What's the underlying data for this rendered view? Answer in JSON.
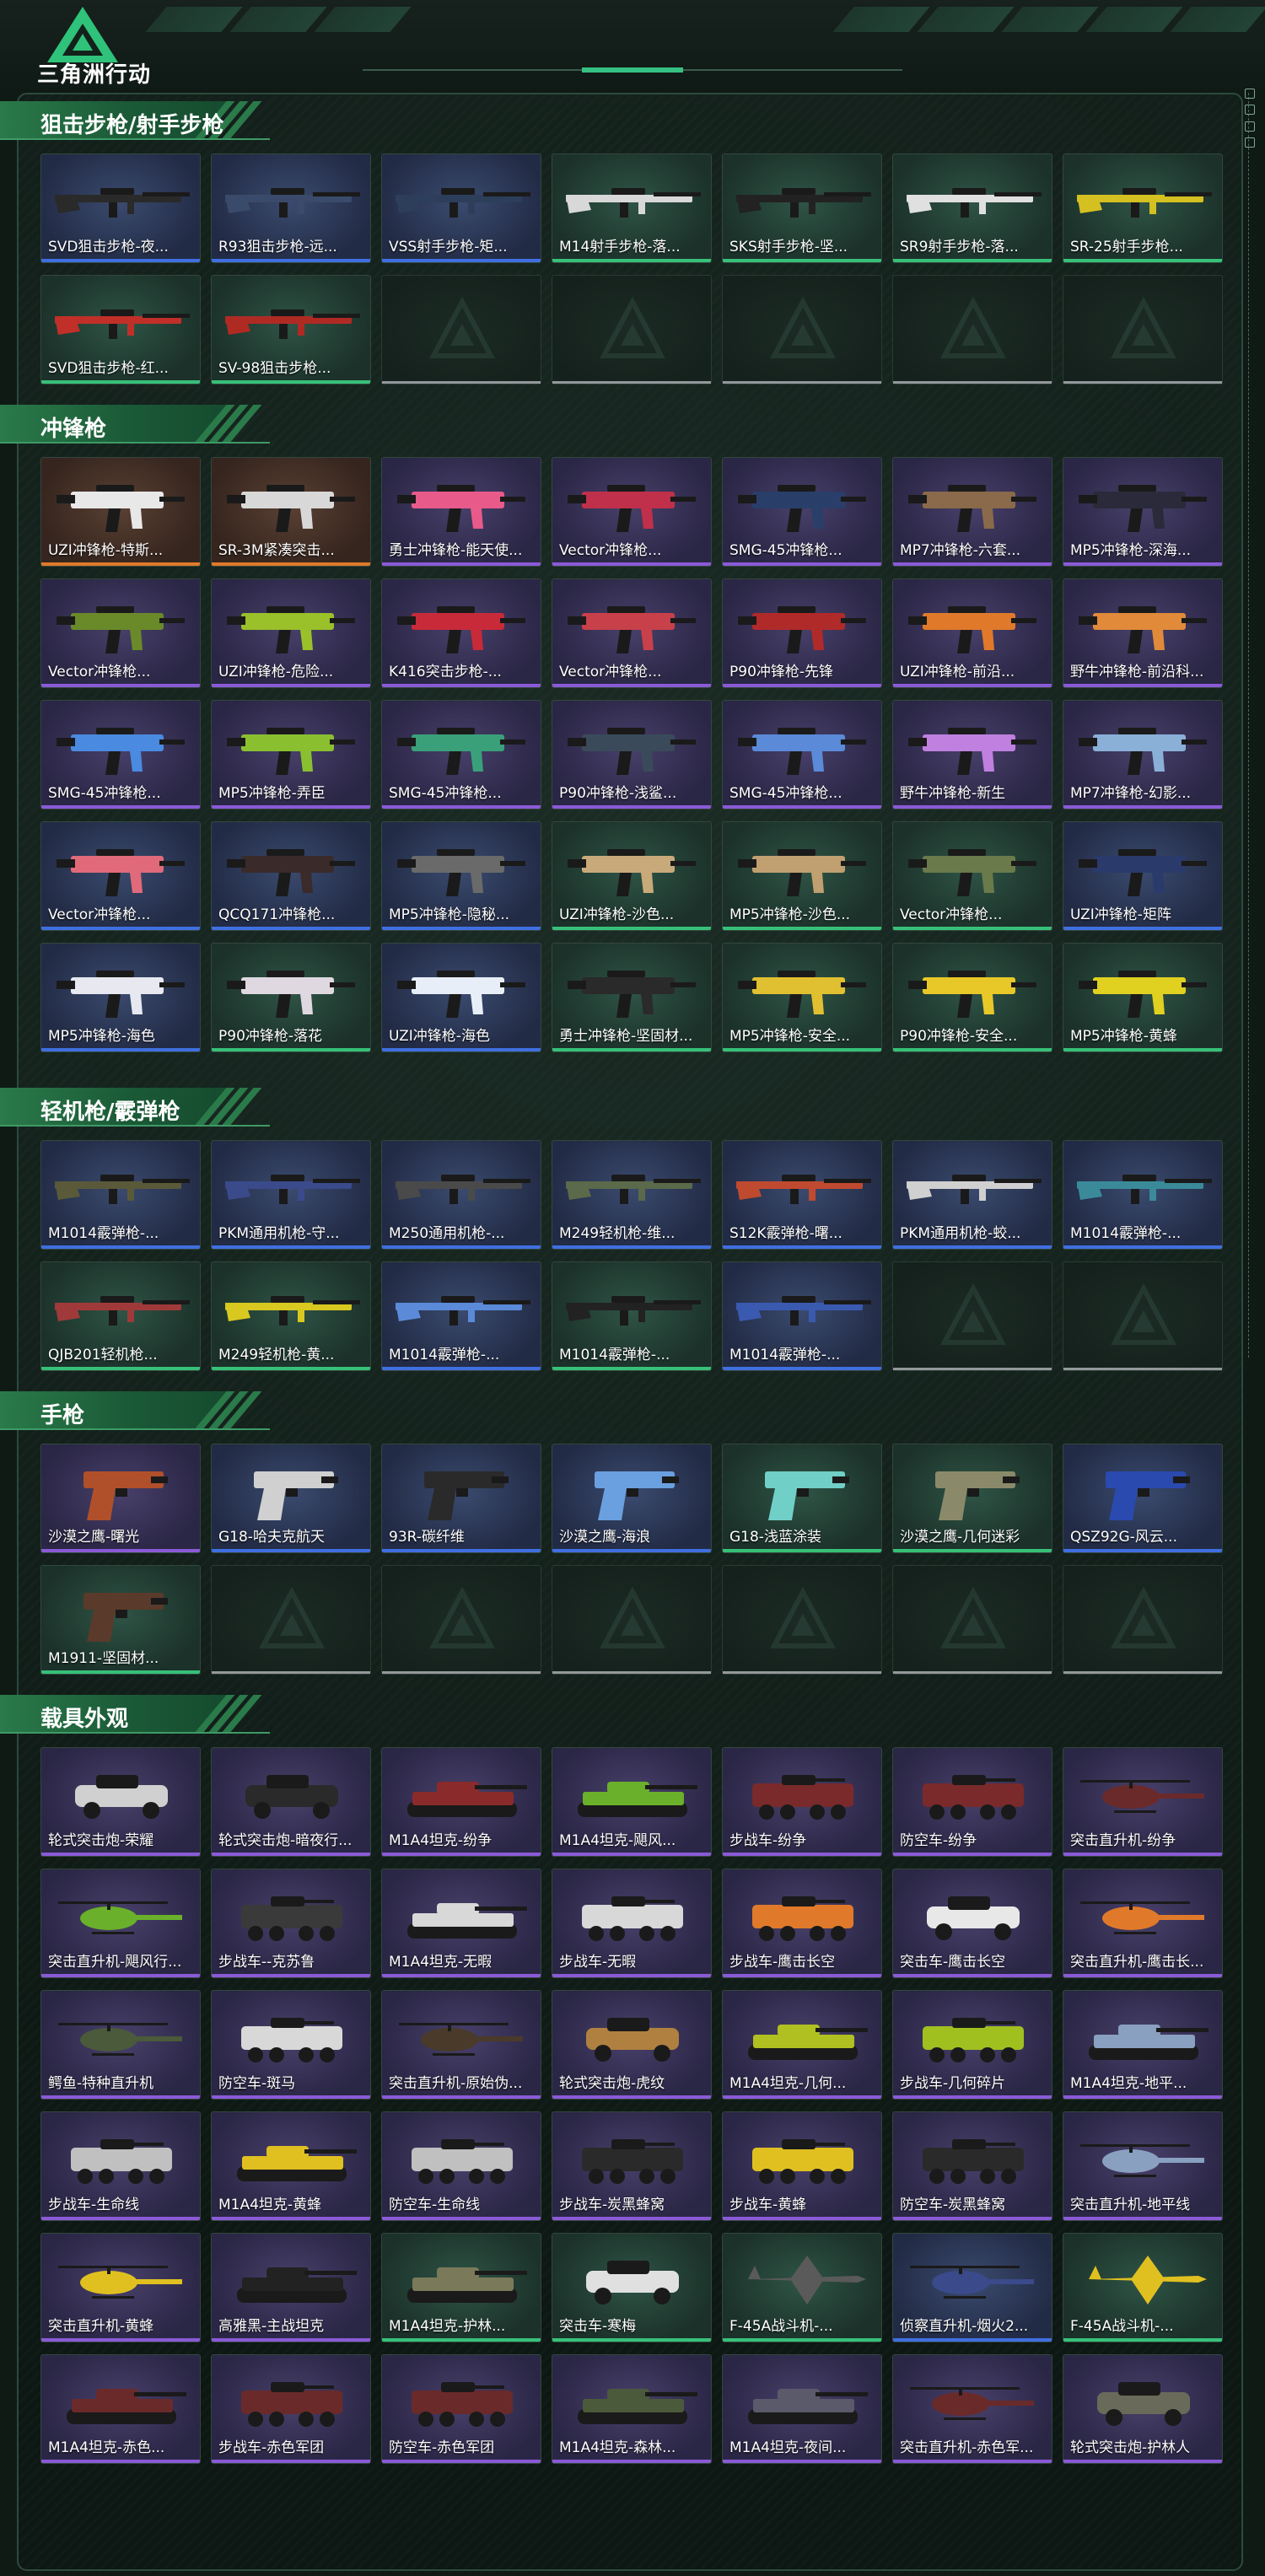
{
  "app": {
    "logo_text": "三角洲行动"
  },
  "colors": {
    "accent": "#2a7a4a",
    "rarity_purple": "#8a5ad6",
    "rarity_blue": "#3f6fe0",
    "rarity_green": "#37c078",
    "rarity_orange": "#e07a2a"
  },
  "sections": [
    {
      "title": "狙击步枪/射手步枪",
      "items": [
        {
          "label": "SVD狙击步枪-夜...",
          "rarity": "blue",
          "kind": "rifle",
          "color": "#2a2a2a"
        },
        {
          "label": "R93狙击步枪-远...",
          "rarity": "blue",
          "kind": "rifle",
          "color": "#3a4a6a"
        },
        {
          "label": "VSS射手步枪-矩...",
          "rarity": "blue",
          "kind": "rifle",
          "color": "#2c3e5a"
        },
        {
          "label": "M14射手步枪-落...",
          "rarity": "green",
          "kind": "rifle",
          "color": "#d8d8d8"
        },
        {
          "label": "SKS射手步枪-坚...",
          "rarity": "green",
          "kind": "rifle",
          "color": "#222222"
        },
        {
          "label": "SR9射手步枪-落...",
          "rarity": "green",
          "kind": "rifle",
          "color": "#e0e0e0"
        },
        {
          "label": "SR-25射手步枪...",
          "rarity": "green",
          "kind": "rifle",
          "color": "#d4c020"
        },
        {
          "label": "SVD狙击步枪-红...",
          "rarity": "green",
          "kind": "rifle",
          "color": "#c03028"
        },
        {
          "label": "SV-98狙击步枪...",
          "rarity": "green",
          "kind": "rifle",
          "color": "#b02a24"
        }
      ],
      "empty_count": 5
    },
    {
      "title": "冲锋枪",
      "items": [
        {
          "label": "UZI冲锋枪-特斯...",
          "rarity": "orange",
          "kind": "smg",
          "color": "#e8e8e8"
        },
        {
          "label": "SR-3M紧凑突击...",
          "rarity": "orange",
          "kind": "smg",
          "color": "#d8d8d8"
        },
        {
          "label": "勇士冲锋枪-能天使...",
          "rarity": "purple",
          "kind": "smg",
          "color": "#e85a8a"
        },
        {
          "label": "Vector冲锋枪...",
          "rarity": "purple",
          "kind": "smg",
          "color": "#c0304a"
        },
        {
          "label": "SMG-45冲锋枪...",
          "rarity": "purple",
          "kind": "smg",
          "color": "#2a3e6a"
        },
        {
          "label": "MP7冲锋枪-六套...",
          "rarity": "purple",
          "kind": "smg",
          "color": "#8a6a4a"
        },
        {
          "label": "MP5冲锋枪-深海...",
          "rarity": "purple",
          "kind": "smg",
          "color": "#2a2a3a"
        },
        {
          "label": "Vector冲锋枪...",
          "rarity": "purple",
          "kind": "smg",
          "color": "#6a8a2a"
        },
        {
          "label": "UZI冲锋枪-危险...",
          "rarity": "purple",
          "kind": "smg",
          "color": "#9ac02a"
        },
        {
          "label": "K416突击步枪-...",
          "rarity": "purple",
          "kind": "smg",
          "color": "#c82a3a"
        },
        {
          "label": "Vector冲锋枪...",
          "rarity": "purple",
          "kind": "smg",
          "color": "#c8404a"
        },
        {
          "label": "P90冲锋枪-先锋",
          "rarity": "purple",
          "kind": "smg",
          "color": "#b02a2a"
        },
        {
          "label": "UZI冲锋枪-前沿...",
          "rarity": "purple",
          "kind": "smg",
          "color": "#e07a2a"
        },
        {
          "label": "野牛冲锋枪-前沿科...",
          "rarity": "purple",
          "kind": "smg",
          "color": "#e08a3a"
        },
        {
          "label": "SMG-45冲锋枪...",
          "rarity": "purple",
          "kind": "smg",
          "color": "#4a8ae0"
        },
        {
          "label": "MP5冲锋枪-弄臣",
          "rarity": "purple",
          "kind": "smg",
          "color": "#8ac030"
        },
        {
          "label": "SMG-45冲锋枪...",
          "rarity": "purple",
          "kind": "smg",
          "color": "#3aa07a"
        },
        {
          "label": "P90冲锋枪-浅鲨...",
          "rarity": "purple",
          "kind": "smg",
          "color": "#3a4a5a"
        },
        {
          "label": "SMG-45冲锋枪...",
          "rarity": "purple",
          "kind": "smg",
          "color": "#5a8ad8"
        },
        {
          "label": "野牛冲锋枪-新生",
          "rarity": "purple",
          "kind": "smg",
          "color": "#c080e0"
        },
        {
          "label": "MP7冲锋枪-幻影...",
          "rarity": "purple",
          "kind": "smg",
          "color": "#8ab0d8"
        },
        {
          "label": "Vector冲锋枪...",
          "rarity": "blue",
          "kind": "smg",
          "color": "#e06a7a"
        },
        {
          "label": "QCQ171冲锋枪...",
          "rarity": "blue",
          "kind": "smg",
          "color": "#3a2a2a"
        },
        {
          "label": "MP5冲锋枪-隐秘...",
          "rarity": "blue",
          "kind": "smg",
          "color": "#6a6a6a"
        },
        {
          "label": "UZI冲锋枪-沙色...",
          "rarity": "green",
          "kind": "smg",
          "color": "#c8aa7a"
        },
        {
          "label": "MP5冲锋枪-沙色...",
          "rarity": "green",
          "kind": "smg",
          "color": "#c0a070"
        },
        {
          "label": "Vector冲锋枪...",
          "rarity": "green",
          "kind": "smg",
          "color": "#6a7a4a"
        },
        {
          "label": "UZI冲锋枪-矩阵",
          "rarity": "blue",
          "kind": "smg",
          "color": "#2a3a6a"
        },
        {
          "label": "MP5冲锋枪-海色",
          "rarity": "blue",
          "kind": "smg",
          "color": "#e8e8f0"
        },
        {
          "label": "P90冲锋枪-落花",
          "rarity": "green",
          "kind": "smg",
          "color": "#e0d8e0"
        },
        {
          "label": "UZI冲锋枪-海色",
          "rarity": "blue",
          "kind": "smg",
          "color": "#e8eef8"
        },
        {
          "label": "勇士冲锋枪-坚固材...",
          "rarity": "green",
          "kind": "smg",
          "color": "#2a2a2a"
        },
        {
          "label": "MP5冲锋枪-安全...",
          "rarity": "green",
          "kind": "smg",
          "color": "#e0c030"
        },
        {
          "label": "P90冲锋枪-安全...",
          "rarity": "green",
          "kind": "smg",
          "color": "#e8c828"
        },
        {
          "label": "MP5冲锋枪-黄蜂",
          "rarity": "green",
          "kind": "smg",
          "color": "#e0d020"
        }
      ],
      "empty_count": 0
    },
    {
      "title": "轻机枪/霰弹枪",
      "items": [
        {
          "label": "M1014霰弹枪-...",
          "rarity": "blue",
          "kind": "rifle",
          "color": "#5a5a3a"
        },
        {
          "label": "PKM通用机枪-守...",
          "rarity": "blue",
          "kind": "rifle",
          "color": "#3a4a8a"
        },
        {
          "label": "M250通用机枪-...",
          "rarity": "blue",
          "kind": "rifle",
          "color": "#4a4a4a"
        },
        {
          "label": "M249轻机枪-维...",
          "rarity": "blue",
          "kind": "rifle",
          "color": "#5a6a4a"
        },
        {
          "label": "S12K霰弹枪-曙...",
          "rarity": "blue",
          "kind": "rifle",
          "color": "#c04a30"
        },
        {
          "label": "PKM通用机枪-蛟...",
          "rarity": "blue",
          "kind": "rifle",
          "color": "#d0d0d0"
        },
        {
          "label": "M1014霰弹枪-...",
          "rarity": "blue",
          "kind": "rifle",
          "color": "#3a8a9a"
        },
        {
          "label": "QJB201轻机枪...",
          "rarity": "green",
          "kind": "rifle",
          "color": "#a03a3a"
        },
        {
          "label": "M249轻机枪-黄...",
          "rarity": "green",
          "kind": "rifle",
          "color": "#d8c820"
        },
        {
          "label": "M1014霰弹枪-...",
          "rarity": "blue",
          "kind": "rifle",
          "color": "#5a8ad8"
        },
        {
          "label": "M1014霰弹枪-...",
          "rarity": "green",
          "kind": "rifle",
          "color": "#222222"
        },
        {
          "label": "M1014霰弹枪-...",
          "rarity": "blue",
          "kind": "rifle",
          "color": "#3a5ab0"
        }
      ],
      "empty_count": 2
    },
    {
      "title": "手枪",
      "items": [
        {
          "label": "沙漠之鹰-曙光",
          "rarity": "purple",
          "kind": "pistol",
          "color": "#b0502a"
        },
        {
          "label": "G18-哈夫克航天",
          "rarity": "blue",
          "kind": "pistol",
          "color": "#d0d0d0"
        },
        {
          "label": "93R-碳纤维",
          "rarity": "blue",
          "kind": "pistol",
          "color": "#2a2a2a"
        },
        {
          "label": "沙漠之鹰-海浪",
          "rarity": "blue",
          "kind": "pistol",
          "color": "#6aa0e0"
        },
        {
          "label": "G18-浅蓝涂装",
          "rarity": "green",
          "kind": "pistol",
          "color": "#70d0c8"
        },
        {
          "label": "沙漠之鹰-几何迷彩",
          "rarity": "green",
          "kind": "pistol",
          "color": "#8a8a6a"
        },
        {
          "label": "QSZ92G-风云...",
          "rarity": "blue",
          "kind": "pistol",
          "color": "#2a4ab0"
        },
        {
          "label": "M1911-坚固材...",
          "rarity": "green",
          "kind": "pistol",
          "color": "#5a3a2a"
        }
      ],
      "empty_count": 6
    },
    {
      "title": "载具外观",
      "items": [
        {
          "label": "轮式突击炮-荣耀",
          "rarity": "purple",
          "kind": "car",
          "color": "#d0d0d0"
        },
        {
          "label": "轮式突击炮-暗夜行...",
          "rarity": "purple",
          "kind": "car",
          "color": "#2a2a2a"
        },
        {
          "label": "M1A4坦克-纷争",
          "rarity": "purple",
          "kind": "tank",
          "color": "#8a2a2a"
        },
        {
          "label": "M1A4坦克-飓风...",
          "rarity": "purple",
          "kind": "tank",
          "color": "#6ab02a"
        },
        {
          "label": "步战车-纷争",
          "rarity": "purple",
          "kind": "apc",
          "color": "#7a2a2a"
        },
        {
          "label": "防空车-纷争",
          "rarity": "purple",
          "kind": "apc",
          "color": "#7a2a2a"
        },
        {
          "label": "突击直升机-纷争",
          "rarity": "purple",
          "kind": "heli",
          "color": "#6a2a2a"
        },
        {
          "label": "突击直升机-飓风行...",
          "rarity": "purple",
          "kind": "heli",
          "color": "#6ab02a"
        },
        {
          "label": "步战车--克苏鲁",
          "rarity": "purple",
          "kind": "apc",
          "color": "#3a3a3a"
        },
        {
          "label": "M1A4坦克-无暇",
          "rarity": "purple",
          "kind": "tank",
          "color": "#d8d8d8"
        },
        {
          "label": "步战车-无暇",
          "rarity": "purple",
          "kind": "apc",
          "color": "#d8d8d8"
        },
        {
          "label": "步战车-鹰击长空",
          "rarity": "purple",
          "kind": "apc",
          "color": "#e07a2a"
        },
        {
          "label": "突击车-鹰击长空",
          "rarity": "purple",
          "kind": "car",
          "color": "#e8e8e8"
        },
        {
          "label": "突击直升机-鹰击长...",
          "rarity": "purple",
          "kind": "heli",
          "color": "#e07a2a"
        },
        {
          "label": "鳄鱼-特种直升机",
          "rarity": "purple",
          "kind": "heli",
          "color": "#4a5a3a"
        },
        {
          "label": "防空车-斑马",
          "rarity": "purple",
          "kind": "apc",
          "color": "#d8d8d8"
        },
        {
          "label": "突击直升机-原始伪...",
          "rarity": "purple",
          "kind": "heli",
          "color": "#4a3a2a"
        },
        {
          "label": "轮式突击炮-虎纹",
          "rarity": "purple",
          "kind": "car",
          "color": "#b08040"
        },
        {
          "label": "M1A4坦克-几何...",
          "rarity": "purple",
          "kind": "tank",
          "color": "#b0c020"
        },
        {
          "label": "步战车-几何碎片",
          "rarity": "purple",
          "kind": "apc",
          "color": "#a0c020"
        },
        {
          "label": "M1A4坦克-地平...",
          "rarity": "purple",
          "kind": "tank",
          "color": "#8aa0c0"
        },
        {
          "label": "步战车-生命线",
          "rarity": "purple",
          "kind": "apc",
          "color": "#c0c0c0"
        },
        {
          "label": "M1A4坦克-黄蜂",
          "rarity": "purple",
          "kind": "tank",
          "color": "#e0c020"
        },
        {
          "label": "防空车-生命线",
          "rarity": "purple",
          "kind": "apc",
          "color": "#c0c0c0"
        },
        {
          "label": "步战车-炭黑蜂窝",
          "rarity": "purple",
          "kind": "apc",
          "color": "#2a2a2a"
        },
        {
          "label": "步战车-黄蜂",
          "rarity": "purple",
          "kind": "apc",
          "color": "#e0c020"
        },
        {
          "label": "防空车-炭黑蜂窝",
          "rarity": "purple",
          "kind": "apc",
          "color": "#2a2a2a"
        },
        {
          "label": "突击直升机-地平线",
          "rarity": "purple",
          "kind": "heli",
          "color": "#8aa0c0"
        },
        {
          "label": "突击直升机-黄蜂",
          "rarity": "purple",
          "kind": "heli",
          "color": "#e0c020"
        },
        {
          "label": "高雅黑-主战坦克",
          "rarity": "purple",
          "kind": "tank",
          "color": "#222222"
        },
        {
          "label": "M1A4坦克-护林...",
          "rarity": "green",
          "kind": "tank",
          "color": "#7a7a5a"
        },
        {
          "label": "突击车-寒梅",
          "rarity": "green",
          "kind": "car",
          "color": "#e0e0e0"
        },
        {
          "label": "F-45A战斗机-...",
          "rarity": "green",
          "kind": "jet",
          "color": "#5a5a5a"
        },
        {
          "label": "侦察直升机-烟火2...",
          "rarity": "blue",
          "kind": "heli",
          "color": "#3a4a8a"
        },
        {
          "label": "F-45A战斗机-...",
          "rarity": "green",
          "kind": "jet",
          "color": "#e0c020"
        },
        {
          "label": "M1A4坦克-赤色...",
          "rarity": "purple",
          "kind": "tank",
          "color": "#6a2a2a"
        },
        {
          "label": "步战车-赤色军团",
          "rarity": "purple",
          "kind": "apc",
          "color": "#6a2a2a"
        },
        {
          "label": "防空车-赤色军团",
          "rarity": "purple",
          "kind": "apc",
          "color": "#6a2a2a"
        },
        {
          "label": "M1A4坦克-森林...",
          "rarity": "purple",
          "kind": "tank",
          "color": "#4a5a3a"
        },
        {
          "label": "M1A4坦克-夜间...",
          "rarity": "purple",
          "kind": "tank",
          "color": "#5a5a6a"
        },
        {
          "label": "突击直升机-赤色军...",
          "rarity": "purple",
          "kind": "heli",
          "color": "#6a2a2a"
        },
        {
          "label": "轮式突击炮-护林人",
          "rarity": "purple",
          "kind": "car",
          "color": "#6a6a5a"
        }
      ],
      "empty_count": 0
    }
  ]
}
